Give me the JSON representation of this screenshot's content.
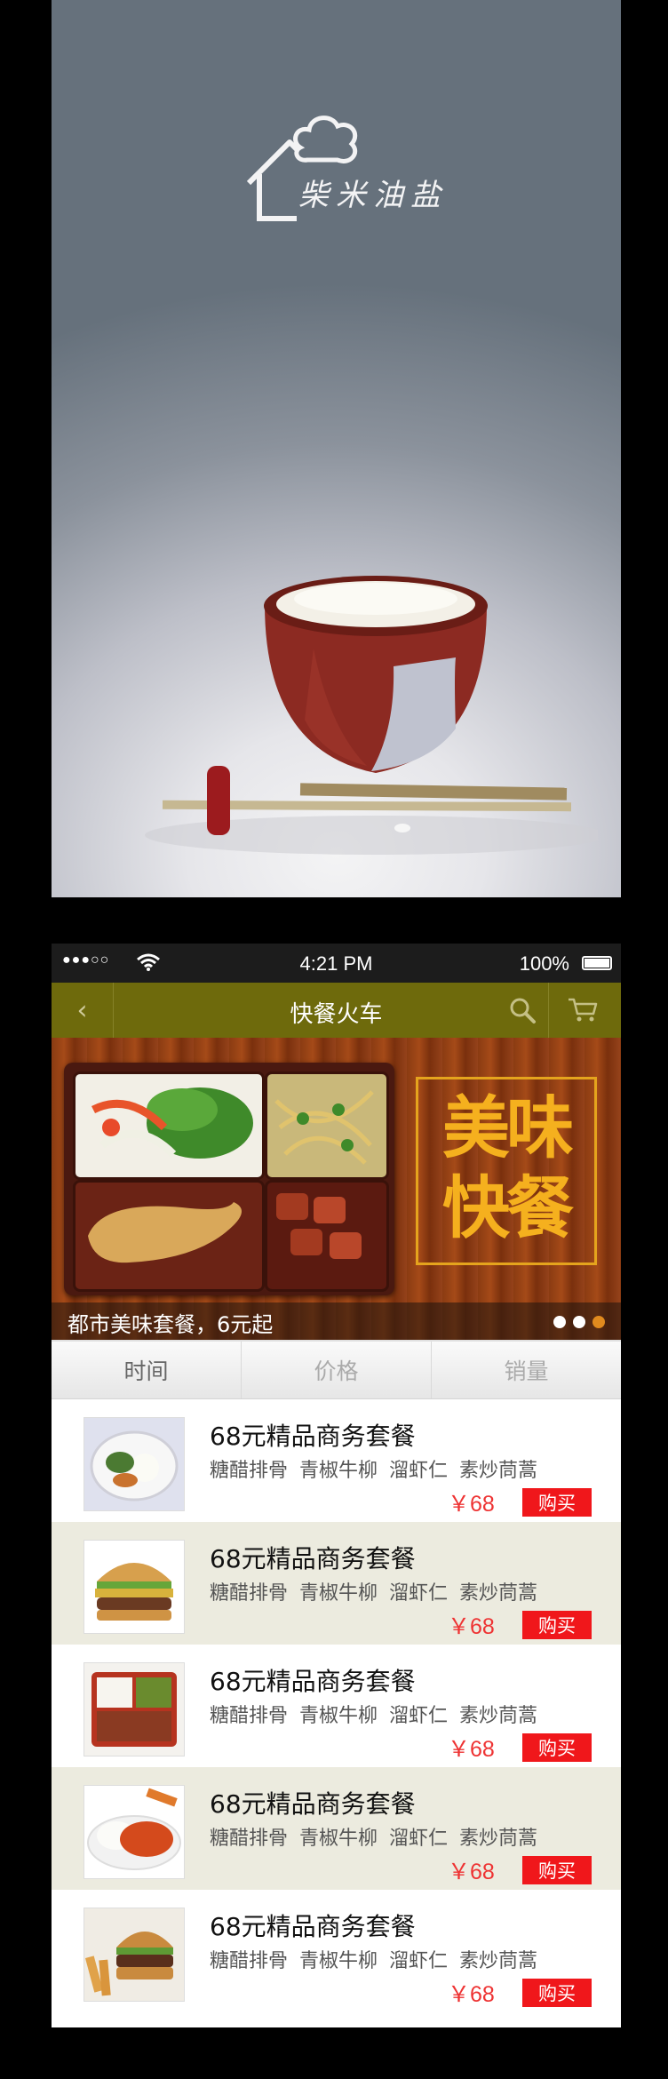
{
  "splash": {
    "logo_text": "柴米油盐"
  },
  "status_bar": {
    "signal": "●●●○○",
    "time": "4:21 PM",
    "battery": "100%"
  },
  "nav": {
    "title": "快餐火车",
    "back_icon": "chevron-left-icon",
    "search_icon": "search-icon",
    "cart_icon": "cart-icon"
  },
  "banner": {
    "title_line1": "美味",
    "title_line2": "快餐",
    "caption": "都市美味套餐，6元起",
    "dot_count": 3,
    "active_dot": 3
  },
  "sort_tabs": [
    {
      "label": "时间",
      "active": true
    },
    {
      "label": "价格",
      "active": false
    },
    {
      "label": "销量",
      "active": false
    }
  ],
  "products": [
    {
      "name": "68元精品商务套餐",
      "desc": "糖醋排骨 青椒牛柳 溜虾仁 素炒茼蒿",
      "price": "￥68",
      "buy_label": "购买"
    },
    {
      "name": "68元精品商务套餐",
      "desc": "糖醋排骨 青椒牛柳 溜虾仁 素炒茼蒿",
      "price": "￥68",
      "buy_label": "购买"
    },
    {
      "name": "68元精品商务套餐",
      "desc": "糖醋排骨 青椒牛柳 溜虾仁 素炒茼蒿",
      "price": "￥68",
      "buy_label": "购买"
    },
    {
      "name": "68元精品商务套餐",
      "desc": "糖醋排骨 青椒牛柳 溜虾仁 素炒茼蒿",
      "price": "￥68",
      "buy_label": "购买"
    },
    {
      "name": "68元精品商务套餐",
      "desc": "糖醋排骨 青椒牛柳 溜虾仁 素炒茼蒿",
      "price": "￥68",
      "buy_label": "购买"
    }
  ],
  "colors": {
    "nav_bar": "#6e6a0c",
    "accent_orange": "#f5b01e",
    "price_red": "#e33333",
    "buy_button": "#f0171b",
    "alt_row": "#ecebdf"
  }
}
